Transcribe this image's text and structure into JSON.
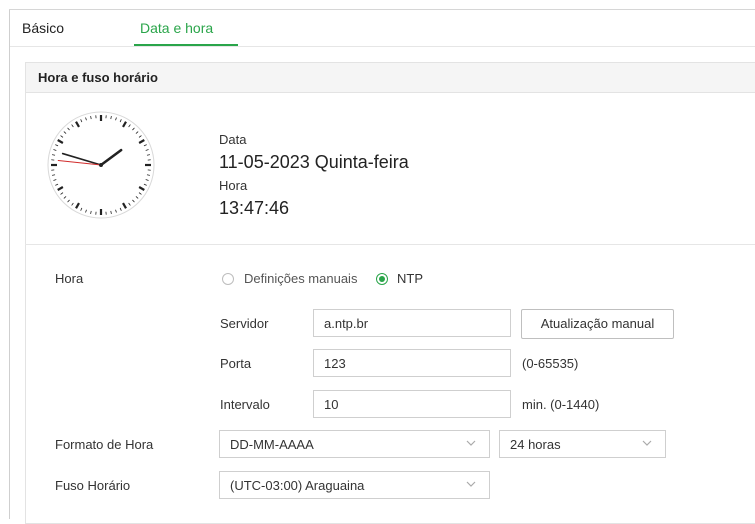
{
  "tabs": [
    {
      "label": "Básico",
      "active": false
    },
    {
      "label": "Data e hora",
      "active": true
    }
  ],
  "accent_color": "#2aa54a",
  "panel": {
    "title": "Hora e fuso horário"
  },
  "clock": {
    "hour": 13,
    "minute": 47,
    "second": 46
  },
  "datetime": {
    "date_label": "Data",
    "date_value": "11-05-2023 Quinta-feira",
    "time_label": "Hora",
    "time_value": "13:47:46"
  },
  "settings": {
    "hora_label": "Hora",
    "mode_options": [
      {
        "label": "Definições manuais",
        "selected": false
      },
      {
        "label": "NTP",
        "selected": true
      }
    ],
    "servidor": {
      "label": "Servidor",
      "value": "a.ntp.br",
      "button": "Atualização manual"
    },
    "porta": {
      "label": "Porta",
      "value": "123",
      "range": "(0-65535)"
    },
    "intervalo": {
      "label": "Intervalo",
      "value": "10",
      "range": "min. (0-1440)"
    },
    "formato_hora": {
      "label": "Formato de Hora",
      "date_format": "DD-MM-AAAA",
      "time_format": "24 horas"
    },
    "fuso_horario": {
      "label": "Fuso Horário",
      "value": "(UTC-03:00) Araguaina"
    }
  }
}
